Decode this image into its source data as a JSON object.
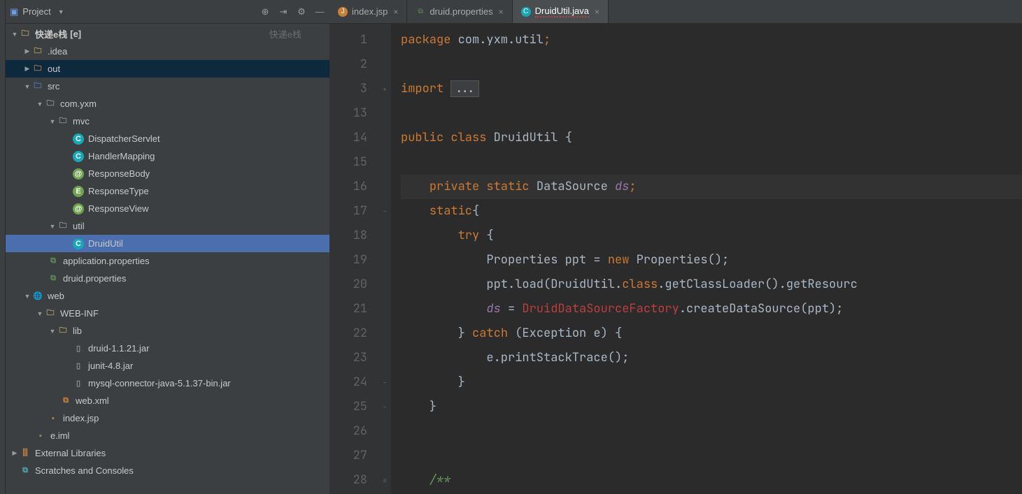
{
  "projectPanel": {
    "title": "Project",
    "tools": [
      "target",
      "collapse",
      "settings",
      "hide"
    ]
  },
  "tree": {
    "root": {
      "label": "快递e栈",
      "suffix": "[e]",
      "hint": "快递e栈"
    },
    "idea": ".idea",
    "out": "out",
    "src": "src",
    "pkg": "com.yxm",
    "mvc": "mvc",
    "mvc_items": [
      "DispatcherServlet",
      "HandlerMapping",
      "ResponseBody",
      "ResponseType",
      "ResponseView"
    ],
    "util": "util",
    "util_item": "DruidUtil",
    "appProps": "application.properties",
    "druidProps": "druid.properties",
    "web": "web",
    "webinf": "WEB-INF",
    "lib": "lib",
    "lib_items": [
      "druid-1.1.21.jar",
      "junit-4.8.jar",
      "mysql-connector-java-5.1.37-bin.jar"
    ],
    "webxml": "web.xml",
    "indexjsp": "index.jsp",
    "eiml": "e.iml",
    "extlib": "External Libraries",
    "scratch": "Scratches and Consoles"
  },
  "tabs": [
    {
      "label": "index.jsp",
      "kind": "jsp",
      "active": false
    },
    {
      "label": "druid.properties",
      "kind": "prop",
      "active": false
    },
    {
      "label": "DruidUtil.java",
      "kind": "java",
      "active": true,
      "squiggle": true
    }
  ],
  "code": {
    "lines": [
      1,
      2,
      3,
      13,
      14,
      15,
      16,
      17,
      18,
      19,
      20,
      21,
      22,
      23,
      24,
      25,
      26,
      27,
      28
    ],
    "fold": [
      "",
      "",
      "+",
      "",
      "",
      "",
      "",
      "-",
      "",
      "",
      "",
      "",
      "",
      "",
      "-",
      "-",
      "",
      "",
      "≡"
    ],
    "highlight_index": 6,
    "src": [
      [
        [
          "kw",
          "package "
        ],
        [
          "ident",
          "com.yxm.util"
        ],
        [
          "semi",
          ";"
        ]
      ],
      [],
      [
        [
          "kw",
          "import "
        ],
        [
          "boxed",
          "..."
        ]
      ],
      [],
      [
        [
          "kw",
          "public class "
        ],
        [
          "ident",
          "DruidUtil {"
        ]
      ],
      [],
      [
        [
          "pad",
          "    "
        ],
        [
          "kw",
          "private static "
        ],
        [
          "type",
          "DataSource "
        ],
        [
          "field",
          "ds"
        ],
        [
          "semi",
          ";"
        ]
      ],
      [
        [
          "pad",
          "    "
        ],
        [
          "kw",
          "static"
        ],
        [
          "ident",
          "{"
        ]
      ],
      [
        [
          "pad",
          "        "
        ],
        [
          "kw",
          "try "
        ],
        [
          "ident",
          "{"
        ]
      ],
      [
        [
          "pad",
          "            "
        ],
        [
          "ident",
          "Properties ppt = "
        ],
        [
          "kw",
          "new "
        ],
        [
          "ident",
          "Properties();"
        ]
      ],
      [
        [
          "pad",
          "            "
        ],
        [
          "ident",
          "ppt.load(DruidUtil."
        ],
        [
          "kw",
          "class"
        ],
        [
          "ident",
          ".getClassLoader().getResourc"
        ]
      ],
      [
        [
          "pad",
          "            "
        ],
        [
          "field",
          "ds"
        ],
        [
          "ident",
          " = "
        ],
        [
          "err",
          "DruidDataSourceFactory"
        ],
        [
          "ident",
          ".createDataSource(ppt);"
        ]
      ],
      [
        [
          "pad",
          "        "
        ],
        [
          "ident",
          "} "
        ],
        [
          "kw",
          "catch "
        ],
        [
          "ident",
          "(Exception e) {"
        ]
      ],
      [
        [
          "pad",
          "            "
        ],
        [
          "ident",
          "e.printStackTrace();"
        ]
      ],
      [
        [
          "pad",
          "        "
        ],
        [
          "ident",
          "}"
        ]
      ],
      [
        [
          "pad",
          "    "
        ],
        [
          "ident",
          "}"
        ]
      ],
      [],
      [],
      [
        [
          "pad",
          "    "
        ],
        [
          "comment",
          "/**"
        ]
      ]
    ]
  }
}
